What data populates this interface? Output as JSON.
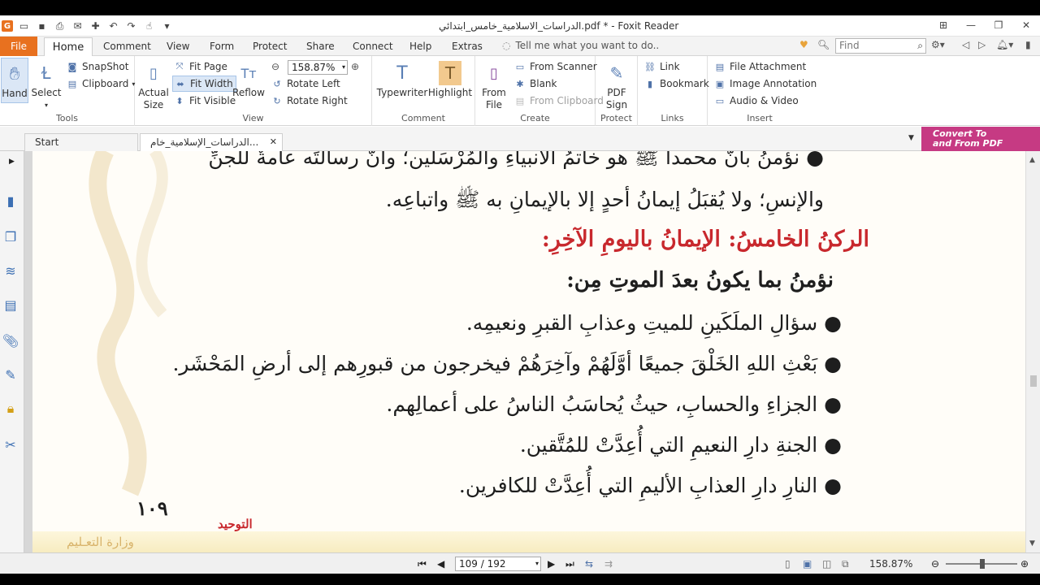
{
  "window": {
    "title": "الدراسات_الاسلامية_خامس_ابتدائي.pdf * - Foxit Reader"
  },
  "menu": {
    "file": "File",
    "home": "Home",
    "items": [
      "Comment",
      "View",
      "Form",
      "Protect",
      "Share",
      "Connect",
      "Help",
      "Extras"
    ],
    "tell_me": "Tell me what you want to do..",
    "find_placeholder": "Find"
  },
  "ribbon": {
    "tools": {
      "label": "Tools",
      "hand": "Hand",
      "select": "Select",
      "snapshot": "SnapShot",
      "clipboard": "Clipboard"
    },
    "view": {
      "label": "View",
      "actual_size": "Actual Size",
      "fit_page": "Fit Page",
      "fit_width": "Fit Width",
      "fit_visible": "Fit Visible",
      "reflow": "Reflow",
      "zoom": "158.87%",
      "rotate_left": "Rotate Left",
      "rotate_right": "Rotate Right"
    },
    "comment": {
      "label": "Comment",
      "typewriter": "Typewriter",
      "highlight": "Highlight"
    },
    "create": {
      "label": "Create",
      "from_file": "From File",
      "from_scanner": "From Scanner",
      "blank": "Blank",
      "from_clipboard": "From Clipboard"
    },
    "protect": {
      "label": "Protect",
      "pdf_sign": "PDF Sign"
    },
    "links": {
      "label": "Links",
      "link": "Link",
      "bookmark": "Bookmark"
    },
    "insert": {
      "label": "Insert",
      "file_attachment": "File Attachment",
      "image_annotation": "Image Annotation",
      "audio_video": "Audio & Video"
    }
  },
  "tabs": {
    "start": "Start",
    "doc": "الدراسات_الإسلامية_خام..."
  },
  "convert": {
    "line1": "Convert To",
    "line2": "and From PDF"
  },
  "page": {
    "line1": "● نؤمنُ بأنَّ محمداً ﷺ هو خاتمُ الأنبياءِ والمُرْسَلين؛ وأنَّ رسالتَه عامةٌ للجنِّ",
    "line2": "والإنسِ؛ ولا يُقبَلُ إيمانُ أحدٍ إلا بالإيمانِ به ﷺ واتباعِه.",
    "heading_red": "الركنُ الخامسُ: الإيمانُ باليومِ الآخِرِ:",
    "heading_black": "نؤمنُ بما يكونُ بعدَ الموتِ مِن:",
    "bullets": [
      "● سؤالِ الملَكَينِ للميتِ وعذابِ القبرِ ونعيمِه.",
      "● بَعْثِ اللهِ الخَلْقَ جميعًا أوَّلَهُمْ وآخِرَهُمْ فيخرجون من قبورِهم إلى أرضِ المَحْشَر.",
      "● الجزاءِ والحسابِ، حيثُ يُحاسَبُ الناسُ على أعمالِهم.",
      "● الجنةِ دارِ النعيمِ التي أُعِدَّتْ للمُتَّقين.",
      "● النارِ دارِ العذابِ الأليمِ التي أُعِدَّتْ للكافرين."
    ],
    "footer_topic": "التوحيد",
    "page_number": "١٠٩",
    "ministry": "وزارة التعـليم"
  },
  "status": {
    "page_box": "109 / 192",
    "zoom": "158.87%"
  },
  "colors": {
    "accent_orange": "#e8711f",
    "heading_red": "#c8282d",
    "convert_pink": "#c63a83"
  }
}
